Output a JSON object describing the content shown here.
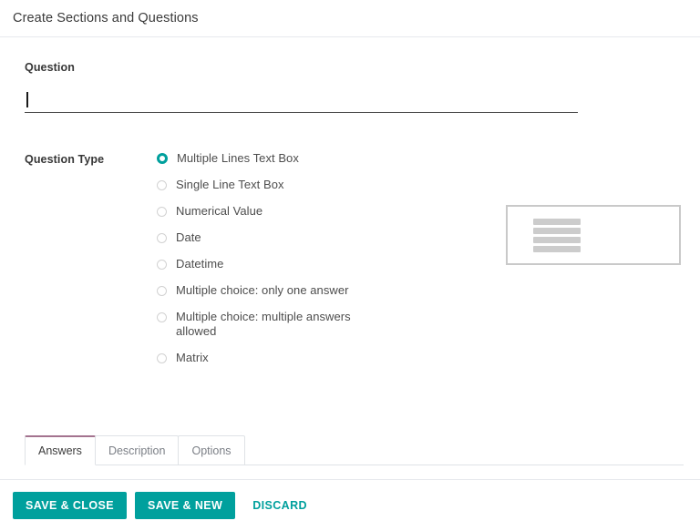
{
  "header": {
    "title": "Create Sections and Questions"
  },
  "form": {
    "question": {
      "label": "Question",
      "value": "",
      "placeholder": ""
    },
    "question_type": {
      "label": "Question Type",
      "selected": "Multiple Lines Text Box",
      "options": [
        {
          "label": "Multiple Lines Text Box",
          "checked": true
        },
        {
          "label": "Single Line Text Box",
          "checked": false
        },
        {
          "label": "Numerical Value",
          "checked": false
        },
        {
          "label": "Date",
          "checked": false
        },
        {
          "label": "Datetime",
          "checked": false
        },
        {
          "label": "Multiple choice: only one answer",
          "checked": false
        },
        {
          "label": "Multiple choice: multiple answers allowed",
          "checked": false
        },
        {
          "label": "Matrix",
          "checked": false
        }
      ]
    },
    "preview": {
      "name": "multiple-lines-preview",
      "line_count": 4
    }
  },
  "tabs": [
    {
      "label": "Answers",
      "active": true
    },
    {
      "label": "Description",
      "active": false
    },
    {
      "label": "Options",
      "active": false
    }
  ],
  "footer": {
    "save_close_label": "SAVE & CLOSE",
    "save_new_label": "SAVE & NEW",
    "discard_label": "DISCARD"
  },
  "colors": {
    "accent": "#00a09d",
    "tab_active_border": "#a3738f",
    "divider": "#e7e9ed",
    "preview_border": "#c9c9c9",
    "preview_line": "#cccccc",
    "text": "#4d4d4d"
  }
}
